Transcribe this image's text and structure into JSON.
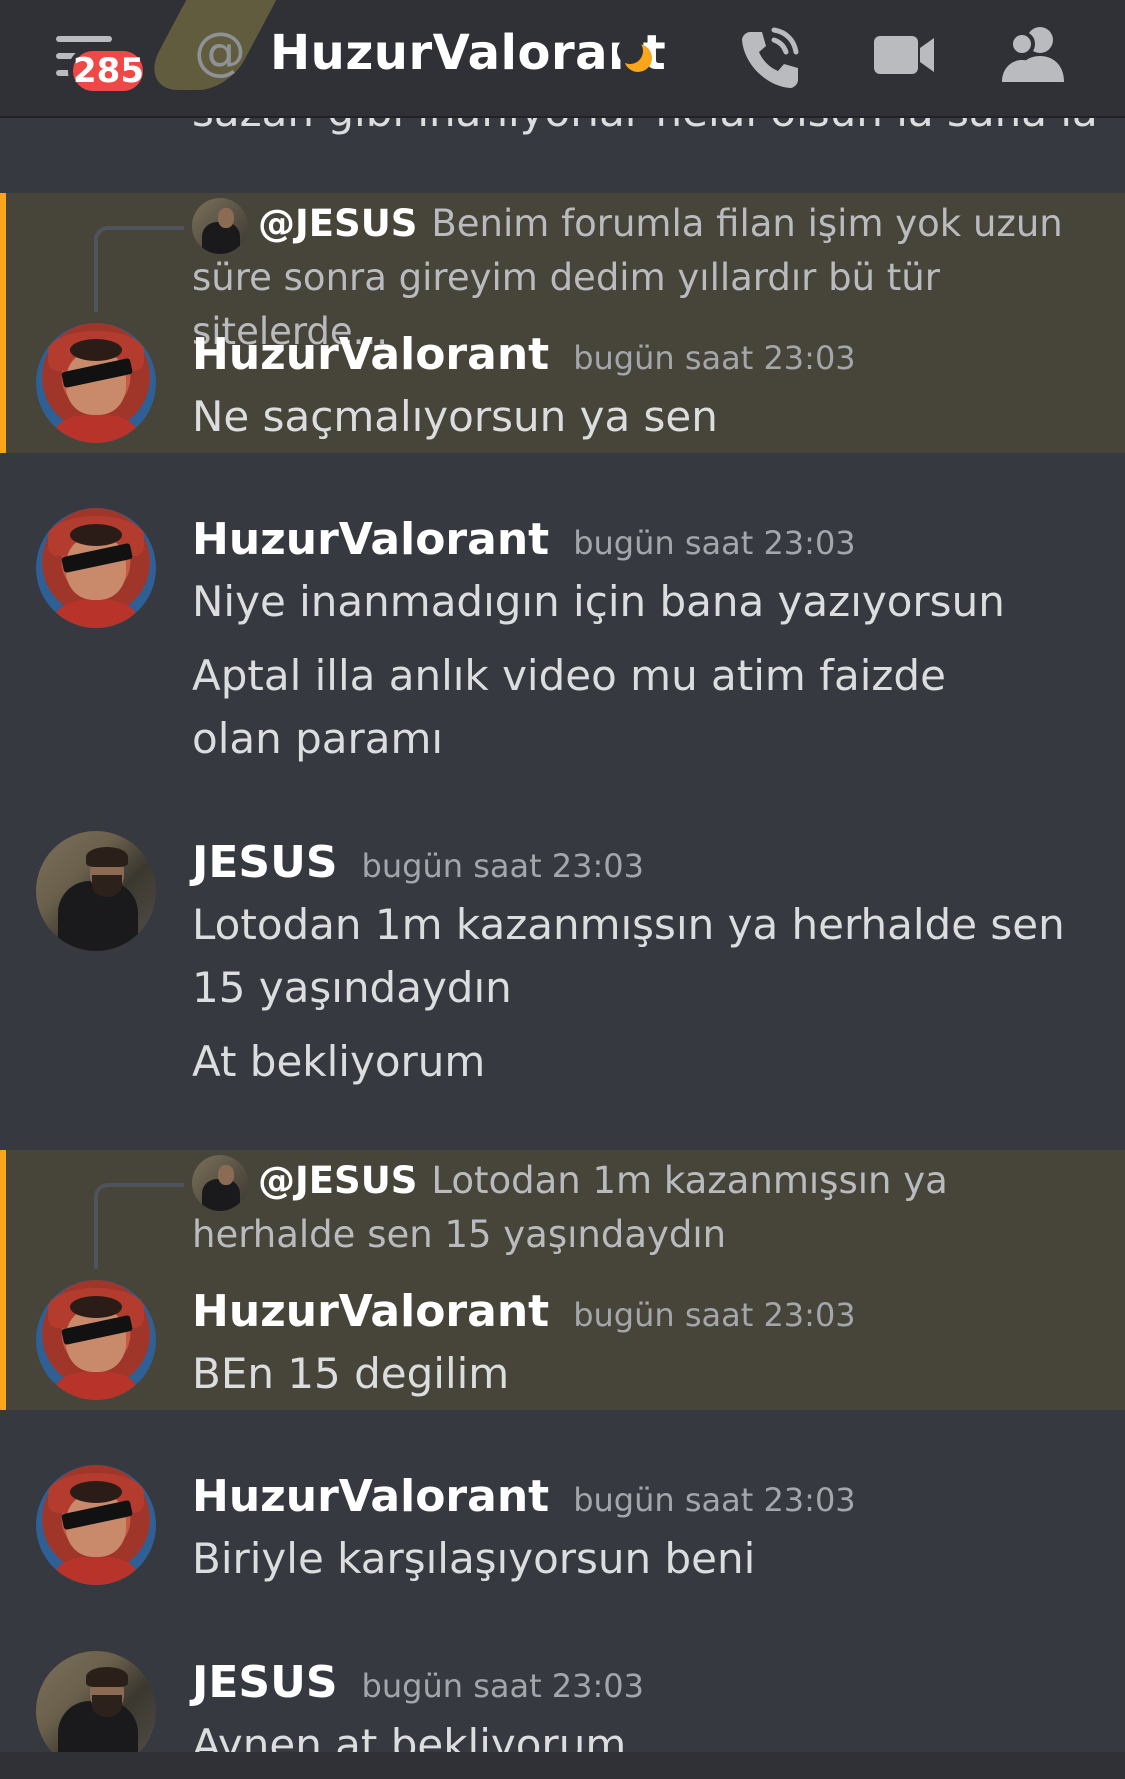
{
  "header": {
    "unread_badge": "285",
    "channel_name": "HuzurValorant",
    "icons": [
      "menu-icon",
      "at-icon",
      "idle-moon-icon",
      "voice-call-icon",
      "video-call-icon",
      "members-icon"
    ]
  },
  "partial_top_text": "sazan gibi inanıyorlar helal olsun la sana la",
  "messages": [
    {
      "author": "HuzurValorant",
      "time": "bugün saat 23:03",
      "highlighted": true,
      "reply": {
        "mention": "@JESUS",
        "text": "Benim forumla filan işim yok  uzun süre sonra gireyim dedim yıllardır bü tür sitelerde..."
      },
      "lines": [
        "Ne saçmalıyorsun ya sen"
      ]
    },
    {
      "author": "HuzurValorant",
      "time": "bugün saat 23:03",
      "highlighted": false,
      "lines": [
        "Niye inanmadıgın için bana yazıyorsun",
        "Aptal illa anlık video mu atim faizde olan paramı"
      ]
    },
    {
      "author": "JESUS",
      "time": "bugün saat 23:03",
      "highlighted": false,
      "lines": [
        "Lotodan 1m kazanmışsın ya herhalde sen 15 yaşındaydın",
        "At bekliyorum"
      ]
    },
    {
      "author": "HuzurValorant",
      "time": "bugün saat 23:03",
      "highlighted": true,
      "reply": {
        "mention": "@JESUS",
        "text": "Lotodan 1m kazanmışsın ya herhalde sen 15 yaşındaydın"
      },
      "lines": [
        "BEn 15 degilim"
      ]
    },
    {
      "author": "HuzurValorant",
      "time": "bugün saat 23:03",
      "highlighted": false,
      "lines": [
        "Biriyle karşılaşıyorsun beni"
      ]
    },
    {
      "author": "JESUS",
      "time": "bugün saat 23:03",
      "highlighted": false,
      "lines": [
        "Aynen at bekliyorum"
      ]
    }
  ],
  "colors": {
    "background": "#36393f",
    "header": "#2f3136",
    "highlight": "#474439",
    "highlight_bar": "#faa61a",
    "badge": "#f04747"
  }
}
